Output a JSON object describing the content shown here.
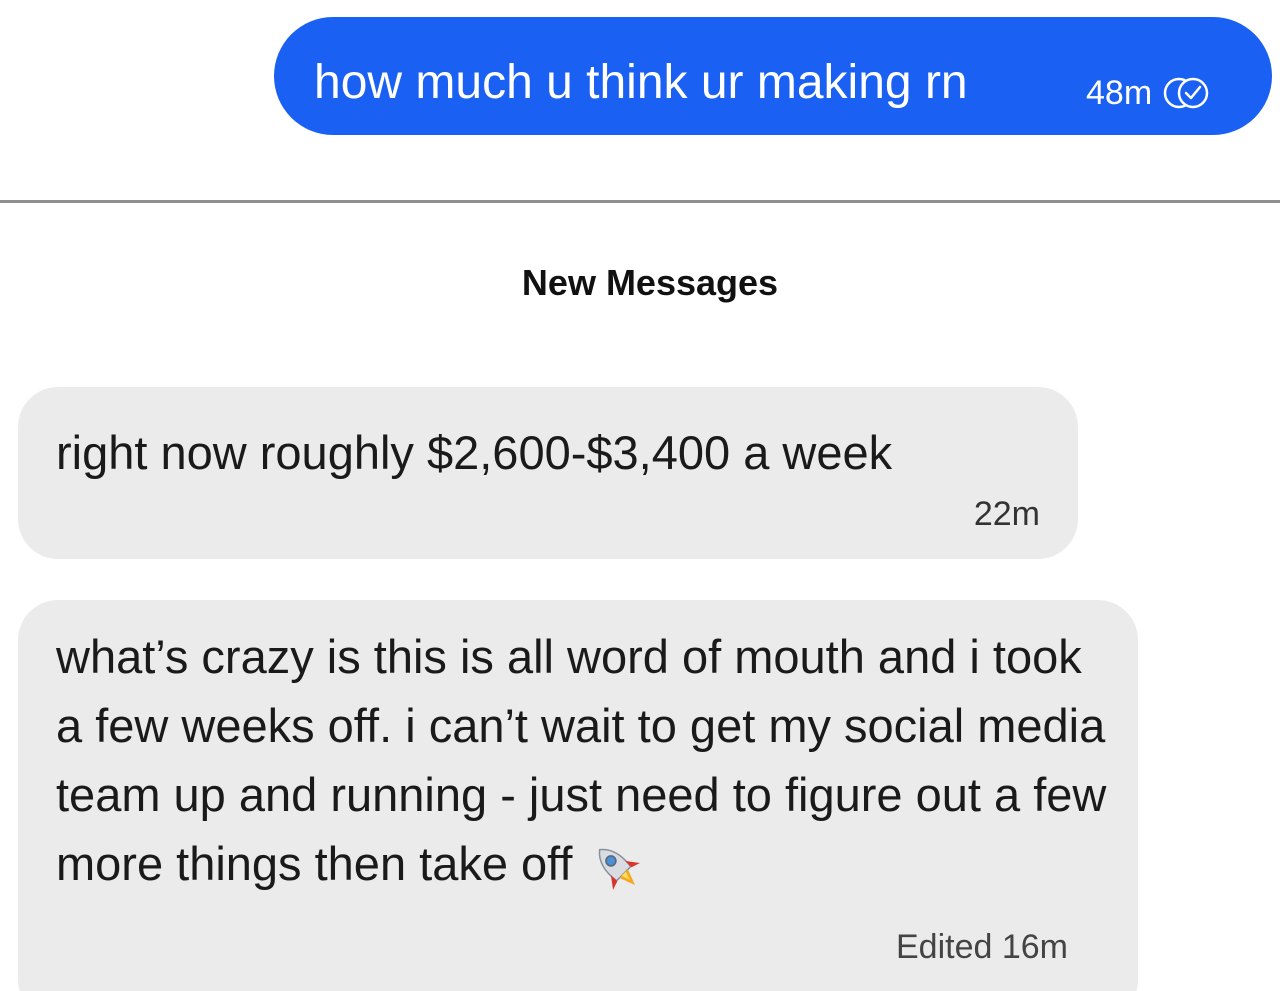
{
  "outgoing_message": {
    "text": "how much u think ur making rn",
    "time": "48m",
    "status_icon": "seen-check-icon",
    "bubble_color": "#1a60f2"
  },
  "separator": {
    "label": "New Messages"
  },
  "incoming_messages": [
    {
      "text": "right now roughly $2,600-$3,400 a week",
      "time": "22m"
    },
    {
      "text": "what’s crazy is this is all word of mouth and i took a few weeks off. i can’t wait to get my social media team up and running - just need to figure out a few more things then take off",
      "emoji": "rocket-icon",
      "meta": "Edited 16m"
    }
  ],
  "colors": {
    "incoming_bubble": "#ebebeb",
    "outgoing_bubble": "#1a60f2",
    "divider": "#8f8f8f"
  }
}
